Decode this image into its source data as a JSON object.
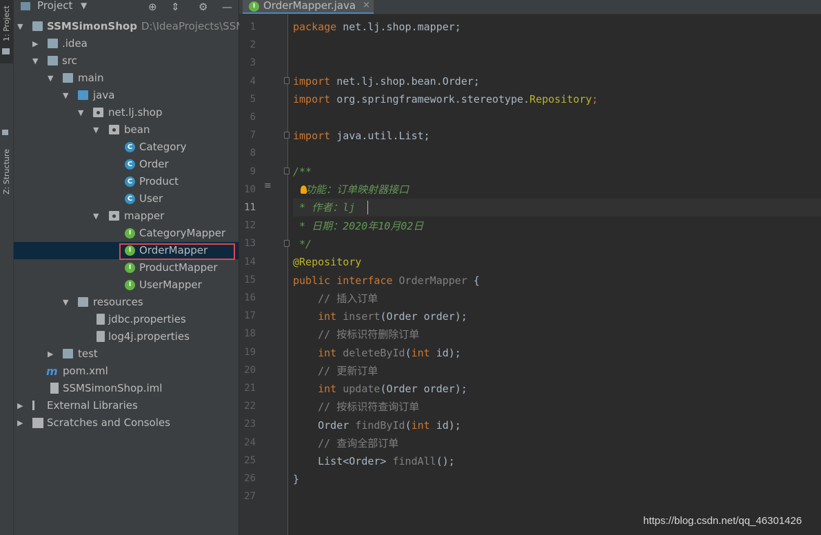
{
  "tool_strip": {
    "project_tab": "1: Project",
    "structure_tab": "Z: Structure"
  },
  "project_panel": {
    "title": "Project",
    "tree": [
      {
        "label": "SSMSimonShop",
        "path": "D:\\IdeaProjects\\SSM",
        "icon": "module-folder-icon"
      },
      {
        "label": ".idea",
        "icon": "folder-icon"
      },
      {
        "label": "src",
        "icon": "folder-icon"
      },
      {
        "label": "main",
        "icon": "folder-icon"
      },
      {
        "label": "java",
        "icon": "source-folder-icon"
      },
      {
        "label": "net.lj.shop",
        "icon": "package-icon"
      },
      {
        "label": "bean",
        "icon": "package-icon"
      },
      {
        "label": "Category",
        "icon": "class-icon"
      },
      {
        "label": "Order",
        "icon": "class-icon"
      },
      {
        "label": "Product",
        "icon": "class-icon"
      },
      {
        "label": "User",
        "icon": "class-icon"
      },
      {
        "label": "mapper",
        "icon": "package-icon"
      },
      {
        "label": "CategoryMapper",
        "icon": "interface-icon"
      },
      {
        "label": "OrderMapper",
        "icon": "interface-icon",
        "selected": true
      },
      {
        "label": "ProductMapper",
        "icon": "interface-icon"
      },
      {
        "label": "UserMapper",
        "icon": "interface-icon"
      },
      {
        "label": "resources",
        "icon": "resources-folder-icon"
      },
      {
        "label": "jdbc.properties",
        "icon": "properties-file-icon"
      },
      {
        "label": "log4j.properties",
        "icon": "properties-file-icon"
      },
      {
        "label": "test",
        "icon": "folder-icon"
      },
      {
        "label": "pom.xml",
        "icon": "maven-icon"
      },
      {
        "label": "SSMSimonShop.iml",
        "icon": "iml-file-icon"
      },
      {
        "label": "External Libraries",
        "icon": "libraries-icon"
      },
      {
        "label": "Scratches and Consoles",
        "icon": "scratches-icon"
      }
    ]
  },
  "editor": {
    "tab_label": "OrderMapper.java",
    "tab_close": "×",
    "current_line": 11,
    "line_numbers": [
      "1",
      "2",
      "3",
      "4",
      "5",
      "6",
      "7",
      "8",
      "9",
      "10",
      "11",
      "12",
      "13",
      "14",
      "15",
      "16",
      "17",
      "18",
      "19",
      "20",
      "21",
      "22",
      "23",
      "24",
      "25",
      "26",
      "27"
    ],
    "code": {
      "l1_kw": "package",
      "l1_rest": " net.lj.shop.mapper;",
      "l4_kw": "import",
      "l4_rest": " net.lj.shop.bean.Order;",
      "l5_kw": "import",
      "l5_rest": " org.springframework.stereotype.",
      "l5_cls": "Repository",
      "l5_end": ";",
      "l7_kw": "import",
      "l7_rest": " java.util.List;",
      "l9": "/**",
      "l10": "  功能：订单映射器接口",
      "l11": " * 作者：lj ",
      "l12": " * 日期：2020年10月02日",
      "l13": " */",
      "l14": "@Repository",
      "l15_kw": "public interface",
      "l15_name": " OrderMapper",
      "l15_end": " {",
      "l16": "    // 插入订单",
      "l17_kw": "    int",
      "l17_fn": " insert",
      "l17_rest": "(Order order);",
      "l18": "    // 按标识符删除订单",
      "l19_kw": "    int",
      "l19_fn": " deleteById",
      "l19_p": "(",
      "l19_kw2": "int",
      "l19_rest": " id);",
      "l20": "    // 更新订单",
      "l21_kw": "    int",
      "l21_fn": " update",
      "l21_rest": "(Order order);",
      "l22": "    // 按标识符查询订单",
      "l23_ty": "    Order",
      "l23_fn": " findById",
      "l23_p": "(",
      "l23_kw": "int",
      "l23_rest": " id);",
      "l24": "    // 查询全部订单",
      "l25_ty": "    List<Order>",
      "l25_fn": " findAll",
      "l25_rest": "();",
      "l26": "}"
    }
  },
  "watermark": "https://blog.csdn.net/qq_46301426",
  "colors": {
    "keyword": "#cc7832",
    "doc_comment": "#629755",
    "line_comment": "#808080",
    "annotation": "#bbb529",
    "selection_box": "#e0474e"
  }
}
